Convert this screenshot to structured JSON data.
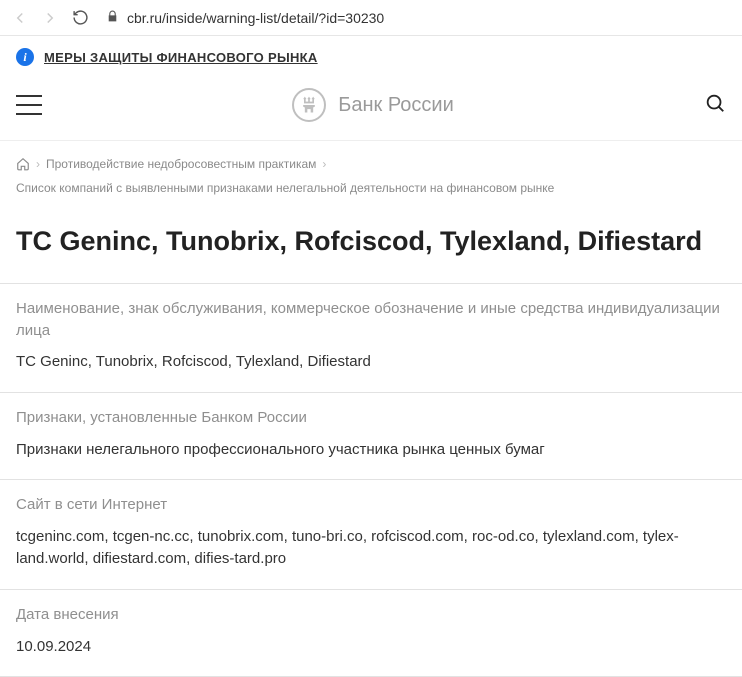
{
  "browser": {
    "url": "cbr.ru/inside/warning-list/detail/?id=30230"
  },
  "notice": "МЕРЫ ЗАЩИТЫ ФИНАНСОВОГО РЫНКА",
  "brand": "Банк России",
  "breadcrumb": {
    "item1": "Противодействие недобросовестным практикам",
    "item2": "Список компаний с выявленными признаками нелегальной деятельности на финансовом рынке"
  },
  "page_title": "TC Geninc, Tunobrix, Rofciscod, Tylexland, Difiestard",
  "sections": {
    "name": {
      "label": "Наименование, знак обслуживания, коммерческое обозначение и иные средства индивидуализации лица",
      "value": "TC Geninc, Tunobrix, Rofciscod, Tylexland, Difiestard"
    },
    "signs": {
      "label": "Признаки, установленные Банком России",
      "value": "Признаки нелегального профессионального участника рынка ценных бумаг"
    },
    "site": {
      "label": "Сайт в сети Интернет",
      "value": "tcgeninc.com, tcgen-nc.cc, tunobrix.com, tuno-bri.co, rofciscod.com, roc-od.co, tylexland.com, tylex-land.world, difiestard.com, difies-tard.pro"
    },
    "date": {
      "label": "Дата внесения",
      "value": "10.09.2024"
    }
  }
}
